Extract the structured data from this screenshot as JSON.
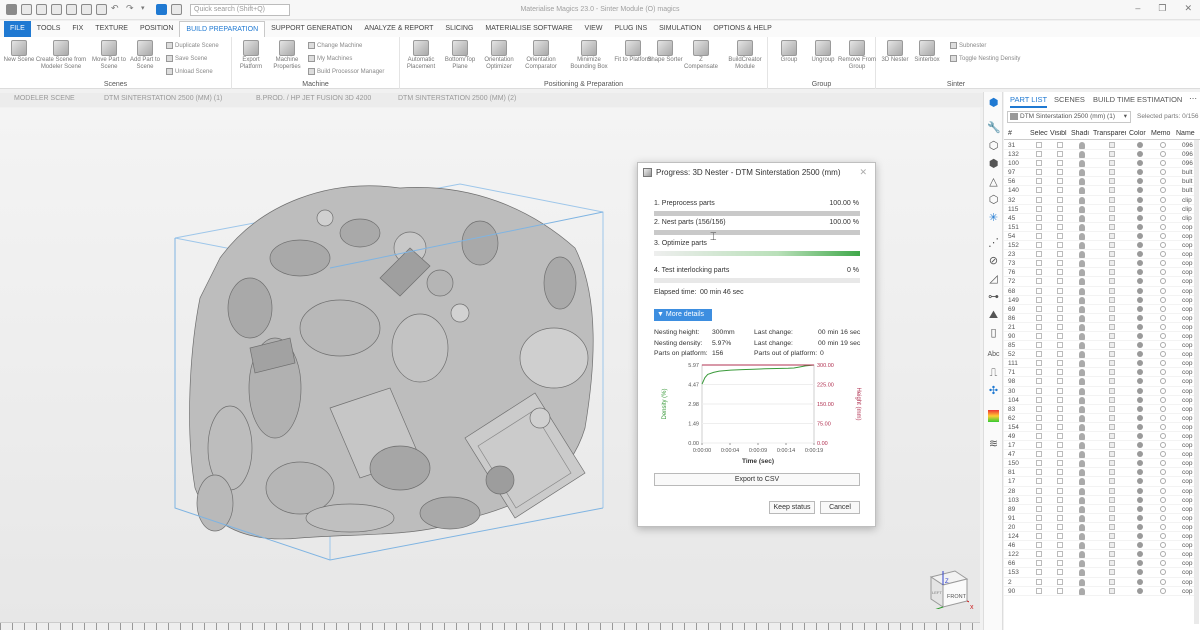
{
  "app": {
    "title": "Materialise Magics 23.0 - Sinter Module (O) magics"
  },
  "search": {
    "placeholder": "Quick search (Shift+Q)"
  },
  "menu": {
    "items": [
      "FILE",
      "TOOLS",
      "FIX",
      "TEXTURE",
      "POSITION",
      "BUILD PREPARATION",
      "SUPPORT GENERATION",
      "ANALYZE & REPORT",
      "SLICING",
      "MATERIALISE SOFTWARE",
      "VIEW",
      "PLUG INS",
      "SIMULATION",
      "OPTIONS & HELP"
    ]
  },
  "ribbon": {
    "scenes": {
      "label": "Scenes",
      "buttons": [
        "New Scene",
        "Create Scene from Modeler Scene",
        "Move Part to Scene",
        "Add Part to Scene"
      ],
      "small": [
        "Duplicate Scene",
        "Save Scene",
        "Unload Scene"
      ]
    },
    "machine": {
      "label": "Machine",
      "buttons": [
        "Export Platform",
        "Machine Properties"
      ],
      "small": [
        "Change Machine",
        "My Machines",
        "Build Processor Manager"
      ]
    },
    "positioning": {
      "label": "Positioning & Preparation",
      "buttons": [
        "Automatic Placement",
        "Bottom/Top Plane",
        "Orientation Optimizer",
        "Orientation Comparator",
        "Minimize Bounding Box",
        "Fit to Platform",
        "Shape Sorter",
        "Z Compensate",
        "BuildCreator Module"
      ]
    },
    "group": {
      "label": "Group",
      "buttons": [
        "Group",
        "Ungroup",
        "Remove From Group"
      ]
    },
    "sinter": {
      "label": "Sinter",
      "buttons": [
        "3D Nester",
        "Sinterbox"
      ],
      "small": [
        "Subnester",
        "Toggle Nesting Density"
      ]
    }
  },
  "scene_tabs": [
    "MODELER SCENE",
    "DTM SINTERSTATION 2500 (MM) (1)",
    "B.PROD. / HP JET FUSION 3D 4200",
    "DTM SINTERSTATION 2500 (MM) (2)"
  ],
  "panel": {
    "tabs": [
      "PART LIST",
      "SCENES",
      "BUILD TIME ESTIMATION"
    ],
    "selector": "DTM Sinterstation 2500 (mm) (1)",
    "selected_parts": "Selected parts: 0/156",
    "columns": [
      "#",
      "Select",
      "Visibl",
      "Shadi",
      "Transparen",
      "Color",
      "Memo",
      "Name"
    ],
    "rows": [
      [
        "31",
        "096"
      ],
      [
        "132",
        "096"
      ],
      [
        "100",
        "096"
      ],
      [
        "97",
        "bult"
      ],
      [
        "56",
        "bult"
      ],
      [
        "140",
        "bult"
      ],
      [
        "32",
        "clip"
      ],
      [
        "115",
        "clip"
      ],
      [
        "45",
        "clip"
      ],
      [
        "151",
        "cop"
      ],
      [
        "54",
        "cop"
      ],
      [
        "152",
        "cop"
      ],
      [
        "23",
        "cop"
      ],
      [
        "73",
        "cop"
      ],
      [
        "76",
        "cop"
      ],
      [
        "72",
        "cop"
      ],
      [
        "68",
        "cop"
      ],
      [
        "149",
        "cop"
      ],
      [
        "69",
        "cop"
      ],
      [
        "86",
        "cop"
      ],
      [
        "21",
        "cop"
      ],
      [
        "90",
        "cop"
      ],
      [
        "85",
        "cop"
      ],
      [
        "52",
        "cop"
      ],
      [
        "111",
        "cop"
      ],
      [
        "71",
        "cop"
      ],
      [
        "98",
        "cop"
      ],
      [
        "30",
        "cop"
      ],
      [
        "104",
        "cop"
      ],
      [
        "83",
        "cop"
      ],
      [
        "62",
        "cop"
      ],
      [
        "154",
        "cop"
      ],
      [
        "49",
        "cop"
      ],
      [
        "17",
        "cop"
      ],
      [
        "47",
        "cop"
      ],
      [
        "150",
        "cop"
      ],
      [
        "81",
        "cop"
      ],
      [
        "17",
        "cop"
      ],
      [
        "28",
        "cop"
      ],
      [
        "103",
        "cop"
      ],
      [
        "89",
        "cop"
      ],
      [
        "91",
        "cop"
      ],
      [
        "20",
        "cop"
      ],
      [
        "124",
        "cop"
      ],
      [
        "46",
        "cop"
      ],
      [
        "122",
        "cop"
      ],
      [
        "66",
        "cop"
      ],
      [
        "153",
        "cop"
      ],
      [
        "2",
        "cop"
      ],
      [
        "90",
        "cop"
      ]
    ]
  },
  "dialog": {
    "title": "Progress: 3D Nester - DTM Sinterstation 2500 (mm)",
    "steps": [
      {
        "label": "1. Preprocess parts",
        "value": "100.00  %",
        "progress": 1.0
      },
      {
        "label": "2. Nest parts  (156/156)",
        "value": "100.00  %",
        "progress": 1.0
      },
      {
        "label": "3. Optimize parts",
        "value": "",
        "progress": 1.0
      },
      {
        "label": "4. Test interlocking parts",
        "value": "0  %",
        "progress": 0.0
      }
    ],
    "elapsed_label": "Elapsed time:",
    "elapsed_value": "00 min 46 sec",
    "more_details": "More details",
    "details": {
      "nesting_height_label": "Nesting height:",
      "nesting_height": "300mm",
      "nesting_density_label": "Nesting density:",
      "nesting_density": "5.97%",
      "parts_on_platform_label": "Parts on platform:",
      "parts_on_platform": "156",
      "last_change_label": "Last change:",
      "last_change_1": "00 min 16 sec",
      "last_change_2": "00 min 19 sec",
      "parts_out_label": "Parts out of platform:",
      "parts_out": "0"
    },
    "export_button": "Export to CSV",
    "keep_button": "Keep status",
    "cancel_button": "Cancel"
  },
  "navcube": {
    "front": "FRONT",
    "left": "LEFT",
    "top": "Z"
  },
  "chart_data": {
    "type": "line",
    "x": [
      "0:00:00",
      "0:00:04",
      "0:00:09",
      "0:00:14",
      "0:00:19"
    ],
    "xlabel": "Time (sec)",
    "ylabel_left": "Density (%)",
    "ylabel_right": "Height (mm)",
    "left_ticks": [
      "5.97",
      "4.47",
      "2.98",
      "1.49",
      "0.00"
    ],
    "right_ticks": [
      "300.00",
      "225.00",
      "150.00",
      "75.00",
      "0.00"
    ],
    "ylim_left": [
      0,
      5.97
    ],
    "ylim_right": [
      0,
      300
    ],
    "series": [
      {
        "axis": "left",
        "color": "#3a9a3a",
        "x": [
          0,
          0.5,
          1,
          2,
          3,
          5,
          7,
          9,
          11,
          13,
          15,
          16,
          17,
          18,
          19.5
        ],
        "values": [
          4.5,
          5.0,
          5.25,
          5.4,
          5.5,
          5.58,
          5.62,
          5.65,
          5.68,
          5.7,
          5.72,
          5.74,
          5.82,
          5.9,
          5.97
        ]
      },
      {
        "axis": "right",
        "color": "#b03050",
        "x": [
          0,
          19.5
        ],
        "values": [
          300,
          300
        ]
      }
    ]
  }
}
